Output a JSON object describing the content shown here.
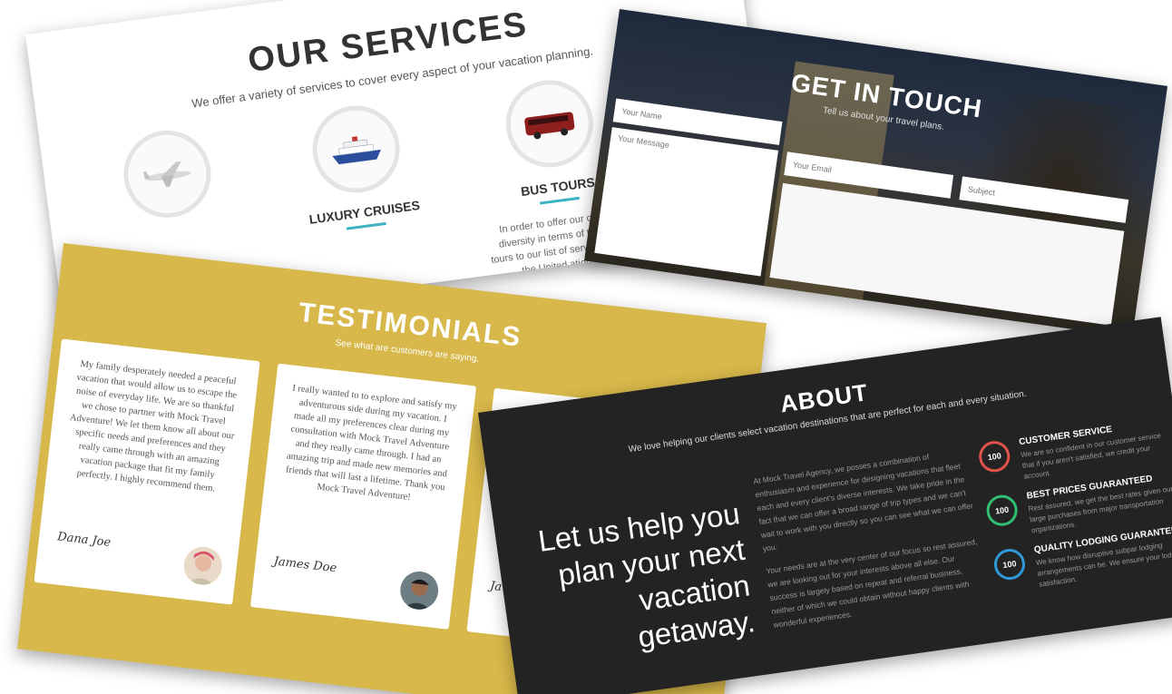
{
  "services": {
    "title": "OUR SERVICES",
    "subtitle": "We offer a variety of services to cover every aspect of your vacation planning.",
    "items": [
      {
        "title": "",
        "description": "",
        "icon": "airplane-icon"
      },
      {
        "title": "LUXURY CRUISES",
        "description": "",
        "icon": "cruise-ship-icon"
      },
      {
        "title": "BUS TOURS",
        "description": "In order to offer our clients m diversity in terms of trip types, tours to our list of services beyond the United ations like",
        "icon": "bus-icon"
      }
    ],
    "accent": "#3bb3c3"
  },
  "contact": {
    "title": "GET IN TOUCH",
    "subtitle": "Tell us about your travel plans.",
    "name_placeholder": "Your Name",
    "message_placeholder": "Your Message",
    "email_placeholder": "Your Email",
    "subject_placeholder": "Subject"
  },
  "testimonials": {
    "title": "TESTIMONIALS",
    "subtitle": "See what are customers are saying.",
    "background": "#d8b84a",
    "items": [
      {
        "quote": "My family desperately needed a peaceful vacation that would allow us to escape the noise of everyday life. We are so thankful we chose to partner with Mock Travel Adventure! We let them know all about our specific needs and preferences and they really came through with an amazing vacation package that fit my family perfectly. I highly recommend them.",
        "signature": "Dana Joe"
      },
      {
        "quote": "I really wanted to to explore and satisfy my adventurous side during my vacation. I made all my preferences clear during my consultation with Mock Travel Adventure and they really came through. I had an amazing trip and made new memories and friends that will last a lifetime. Thank you Mock Travel Adventure!",
        "signature": "James Doe"
      },
      {
        "quote": "",
        "signature": "Ja"
      }
    ]
  },
  "about": {
    "title": "ABOUT",
    "subtitle": "We love helping our clients select vacation destinations that are perfect for each and every situation.",
    "headline": "Let us help you plan your next vacation getaway.",
    "paragraph1": "At Mock Travel Agency, we posses a combination of enthusiasm and experience for designing vacations that fleet each and every client's diverse interests. We take pride in the fact that we can offer a broad range of trip types and we can't wait to work with you directly so you can see what we can offer you.",
    "paragraph2": "Your needs are at the very center of our focus so rest assured, we are looking out for your interests above all else. Our success is largely based on repeat and referral business, neither of which we could obtain without happy clients with wonderful experiences.",
    "features": [
      {
        "value": "100",
        "title": "CUSTOMER SERVICE",
        "description": "We are so confident in our customer service that if you aren't satisfied, we credit your account.",
        "color": "#e0524a"
      },
      {
        "value": "100",
        "title": "BEST PRICES GUARANTEED",
        "description": "Rest assured, we get the best rates given our large purchases from major transportation organizations.",
        "color": "#2fbf71"
      },
      {
        "value": "100",
        "title": "QUALITY LODGING GUARANTEED",
        "description": "We know how disruptive subpar lodging arrangements can be. We ensure your lodging satisfaction.",
        "color": "#2f9ad8"
      }
    ]
  }
}
